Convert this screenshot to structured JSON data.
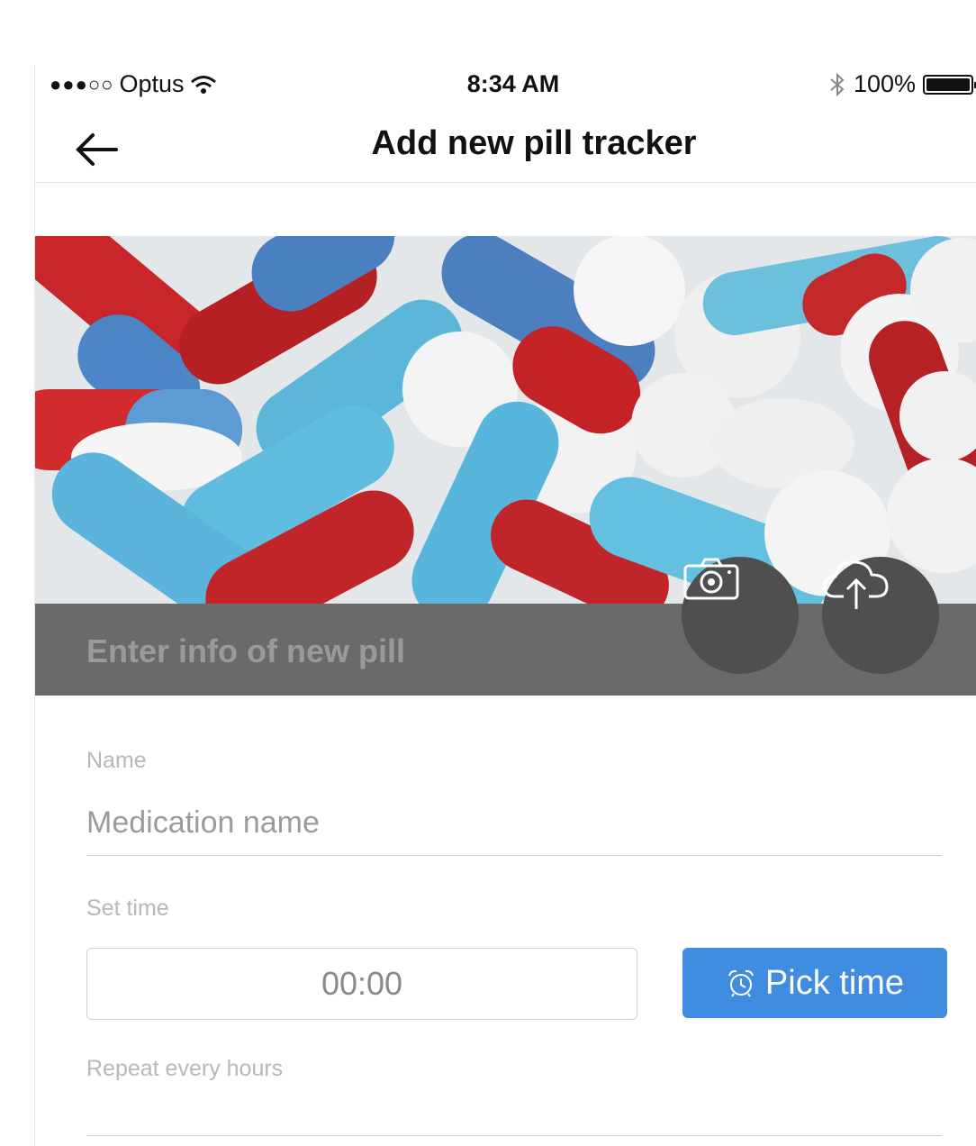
{
  "status_bar": {
    "signal": "●●●○○",
    "carrier": "Optus",
    "time": "8:34 AM",
    "battery": "100%",
    "battery_level": 1.0
  },
  "nav": {
    "title": "Add new pill tracker",
    "back_icon": "arrow-left-icon"
  },
  "hero": {
    "caption": "Enter info of new pill",
    "camera_icon": "camera-icon",
    "upload_icon": "cloud-upload-icon"
  },
  "form": {
    "name_label": "Name",
    "name_placeholder": "Medication name",
    "time_label": "Set time",
    "time_value": "00:00",
    "pick_time_label": "Pick time",
    "pick_time_icon": "alarm-clock-icon",
    "repeat_label": "Repeat every hours"
  },
  "colors": {
    "accent": "#3f8ce0",
    "caption_bar": "#6a6a6a",
    "circle_button": "#4f4f4f"
  }
}
